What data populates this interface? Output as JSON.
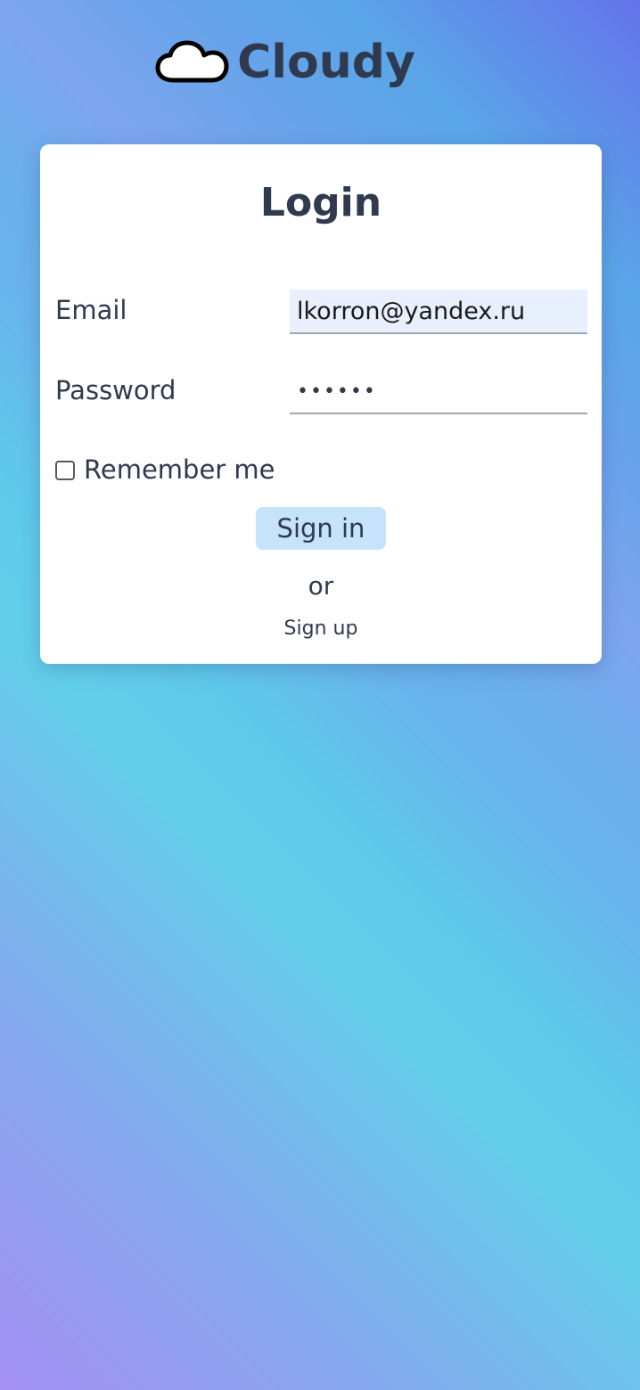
{
  "brand": {
    "name": "Cloudy",
    "icon": "cloud-icon"
  },
  "login": {
    "title": "Login",
    "email_label": "Email",
    "email_value": "lkorron@yandex.ru",
    "password_label": "Password",
    "password_value": "••••••",
    "remember_label": "Remember me",
    "remember_checked": false,
    "signin_label": "Sign in",
    "or_text": "or",
    "signup_label": "Sign up"
  },
  "colors": {
    "text": "#2f3a4f",
    "button_bg": "#c5e3fa",
    "email_field_bg": "#e8effd",
    "card_bg": "#ffffff"
  }
}
